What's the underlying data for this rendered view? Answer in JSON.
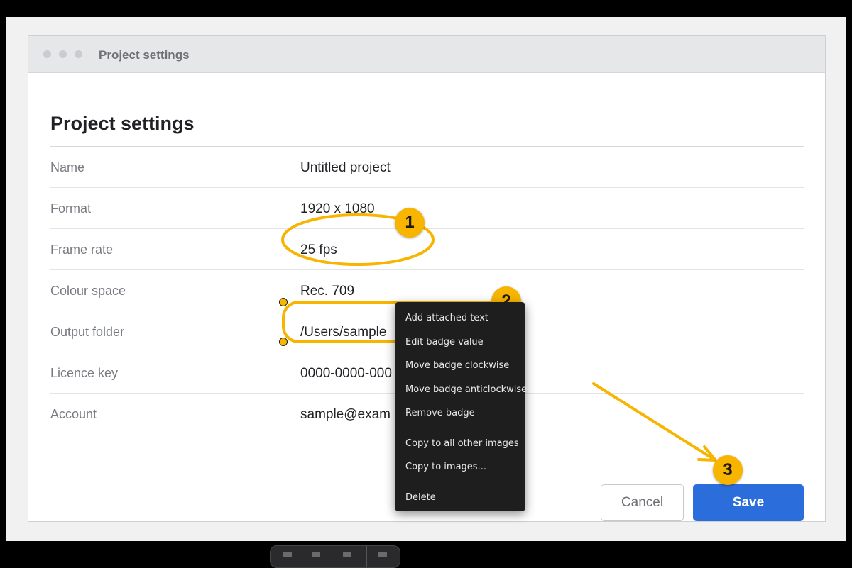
{
  "window": {
    "title": "Project settings"
  },
  "page": {
    "title": "Project settings"
  },
  "settings": [
    {
      "label": "Name",
      "value": "Untitled project"
    },
    {
      "label": "Format",
      "value": "1920 x 1080"
    },
    {
      "label": "Frame rate",
      "value": "25 fps"
    },
    {
      "label": "Colour space",
      "value": "Rec. 709"
    },
    {
      "label": "Output folder",
      "value": "/Users/sample"
    },
    {
      "label": "Licence key",
      "value": "0000-0000-000"
    },
    {
      "label": "Account",
      "value": "sample@exam"
    }
  ],
  "buttons": {
    "cancel": "Cancel",
    "save": "Save"
  },
  "annotations": {
    "badges": [
      "1",
      "2",
      "3"
    ],
    "color": "#f7b500"
  },
  "context_menu": {
    "items": [
      "Add attached text",
      "Edit badge value",
      "Move badge clockwise",
      "Move badge anticlockwise",
      "Remove badge",
      "Copy to all other images",
      "Copy to images...",
      "Delete"
    ]
  }
}
